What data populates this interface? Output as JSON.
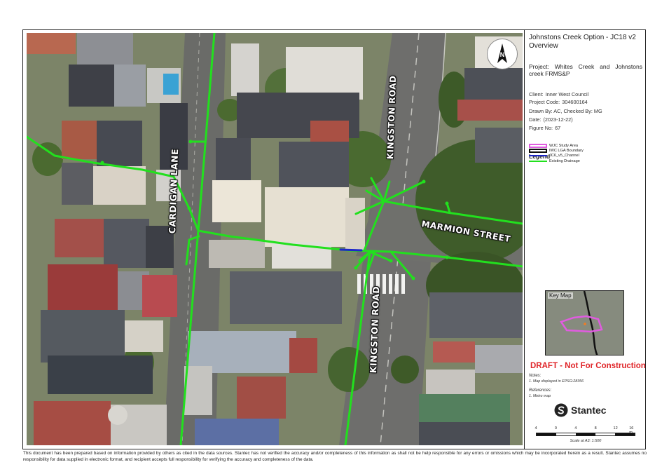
{
  "map": {
    "road_labels": {
      "cardigan_lane": "CARDIGAN LANE",
      "kingston_road_top": "KINGSTON ROAD",
      "kingston_road_bottom": "KINGSTON ROAD",
      "marmion_street": "MARMION STREET"
    },
    "north_arrow_letter": "N",
    "colors": {
      "existing_drainage": "#22e01e",
      "channel": "#1d27c9",
      "road": "#6e6e6c"
    }
  },
  "title_block": {
    "title": "Johnstons Creek Option - JC18 v2 Overview",
    "project_label": "Project:",
    "project_value": "Whites Creek and Johnstons creek FRMS&P",
    "client_label": "Client:",
    "client_value": "Inner West Council",
    "project_code_label": "Project Code:",
    "project_code_value": "304600164",
    "drawn_by": "Drawn By: AC, Checked By: MG",
    "date_label": "Date:",
    "date_value": "(2023-12-22)",
    "figure_label": "Figure No:",
    "figure_value": "67",
    "legend_title": "Legend",
    "legend": [
      {
        "label": "WJC Study Area",
        "symbol": "polygon",
        "color": "#e05ce0"
      },
      {
        "label": "IWC LGA Boundary",
        "symbol": "polygon",
        "color": "#111111"
      },
      {
        "label": "JC6_v5_Channel",
        "symbol": "line",
        "color": "#1d27c9"
      },
      {
        "label": "Existing Drainage",
        "symbol": "line",
        "color": "#22e01e"
      }
    ],
    "key_map_title": "Key Map",
    "draft": "DRAFT - Not For Construction",
    "notes_heading": "Notes:",
    "notes_text": "1. Map displayed in EPSG:28356",
    "references_heading": "References:",
    "references_text": "1. Metro map",
    "logo_text": "Stantec",
    "scale_ticks": [
      "4",
      "0",
      "4",
      "8",
      "12",
      "16 m"
    ],
    "scale_text": "Scale at A3: 1:500"
  },
  "disclaimer": "This document has been prepared based on information provided by others as cited in the data sources. Stantec has not verified the accuracy and/or completeness of this information as shall not be help responsible for any errors or omissions which may be incorporated herein as a result. Stantec assumes no responsibility for data supplied in electronic format, and recipient accepts full responsibility for verifying the accuracy and completeness of the data."
}
